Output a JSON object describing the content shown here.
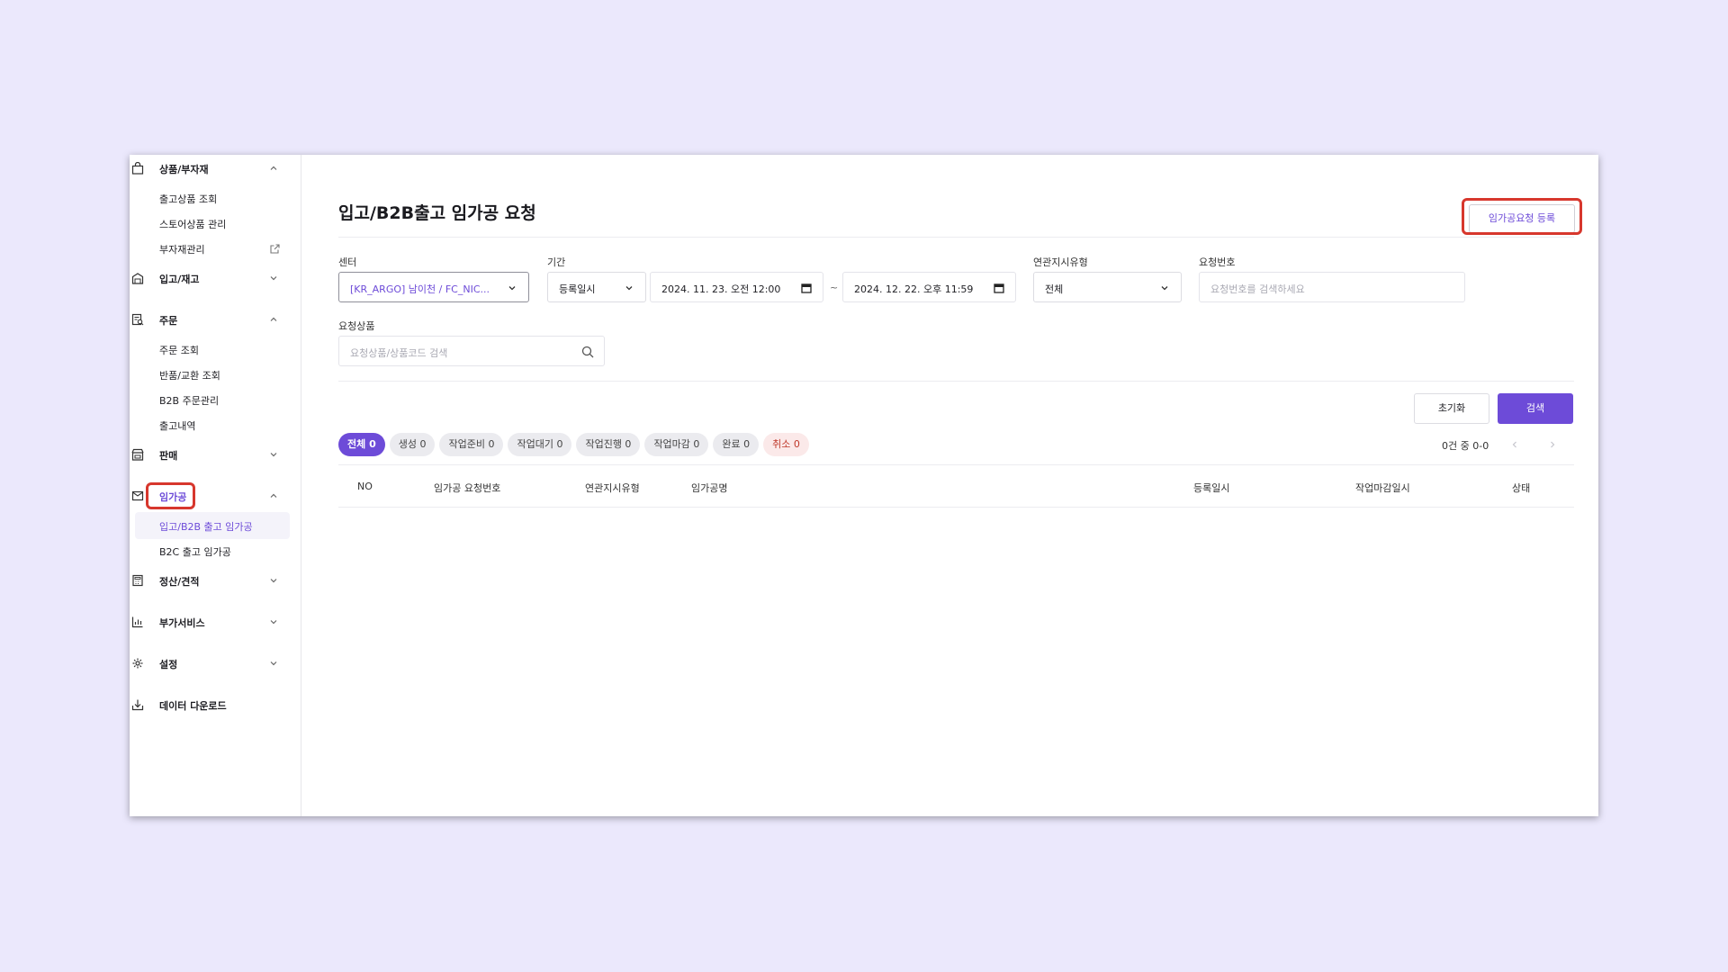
{
  "sidebar": {
    "groups": {
      "products": {
        "label": "상품/부자재",
        "icon": "bag-icon",
        "expanded": true
      },
      "inbound": {
        "label": "입고/재고",
        "icon": "warehouse-icon",
        "expanded": false
      },
      "orders": {
        "label": "주문",
        "icon": "order-search-icon",
        "expanded": true
      },
      "sales": {
        "label": "판매",
        "icon": "store-icon",
        "expanded": false
      },
      "processing": {
        "label": "임가공",
        "icon": "inbox-icon",
        "expanded": true
      },
      "settlement": {
        "label": "정산/견적",
        "icon": "calculator-icon",
        "expanded": false
      },
      "addon": {
        "label": "부가서비스",
        "icon": "chart-icon",
        "expanded": false
      },
      "settings": {
        "label": "설정",
        "icon": "gear-icon",
        "expanded": false
      },
      "download": {
        "label": "데이터 다운로드",
        "icon": "download-icon"
      }
    },
    "items": {
      "outbound_products": "출고상품 조회",
      "store_products": "스토어상품 관리",
      "materials": "부자재관리",
      "order_lookup": "주문 조회",
      "returns": "반품/교환 조회",
      "b2b_orders": "B2B 주문관리",
      "shipping_history": "출고내역",
      "inbound_b2b_processing": "입고/B2B 출고 임가공",
      "b2c_processing": "B2C 출고 임가공"
    }
  },
  "main": {
    "title": "입고/B2B출고 임가공 요청",
    "register_button": "임가공요청 등록",
    "filters": {
      "center_label": "센터",
      "center_value": "[KR_ARGO] 남이천 / FC_NIC...",
      "period_label": "기간",
      "period_type": "등록일시",
      "date_from": "2024. 11. 23. 오전 12:00",
      "date_separator": "~",
      "date_to": "2024. 12. 22. 오후 11:59",
      "instruction_type_label": "연관지시유형",
      "instruction_type_value": "전체",
      "request_no_label": "요청번호",
      "request_no_placeholder": "요청번호를 검색하세요",
      "request_product_label": "요청상품",
      "request_product_placeholder": "요청상품/상품코드 검색"
    },
    "reset_button": "초기화",
    "search_button": "검색",
    "status_chips": {
      "all": "전체 0",
      "created": "생성 0",
      "preparing": "작업준비 0",
      "waiting": "작업대기 0",
      "in_progress": "작업진행 0",
      "closing": "작업마감 0",
      "done": "완료 0",
      "cancelled": "취소 0"
    },
    "pager": {
      "count": "0건 중 0-0"
    },
    "table": {
      "headers": {
        "no": "NO",
        "request_no": "임가공 요청번호",
        "instruction_type": "연관지시유형",
        "name": "임가공명",
        "registered_at": "등록일시",
        "deadline": "작업마감일시",
        "status": "상태"
      },
      "rows": []
    }
  },
  "colors": {
    "accent": "#6d4bd8",
    "highlight": "#d7372d",
    "background": "#ebe8fc"
  }
}
